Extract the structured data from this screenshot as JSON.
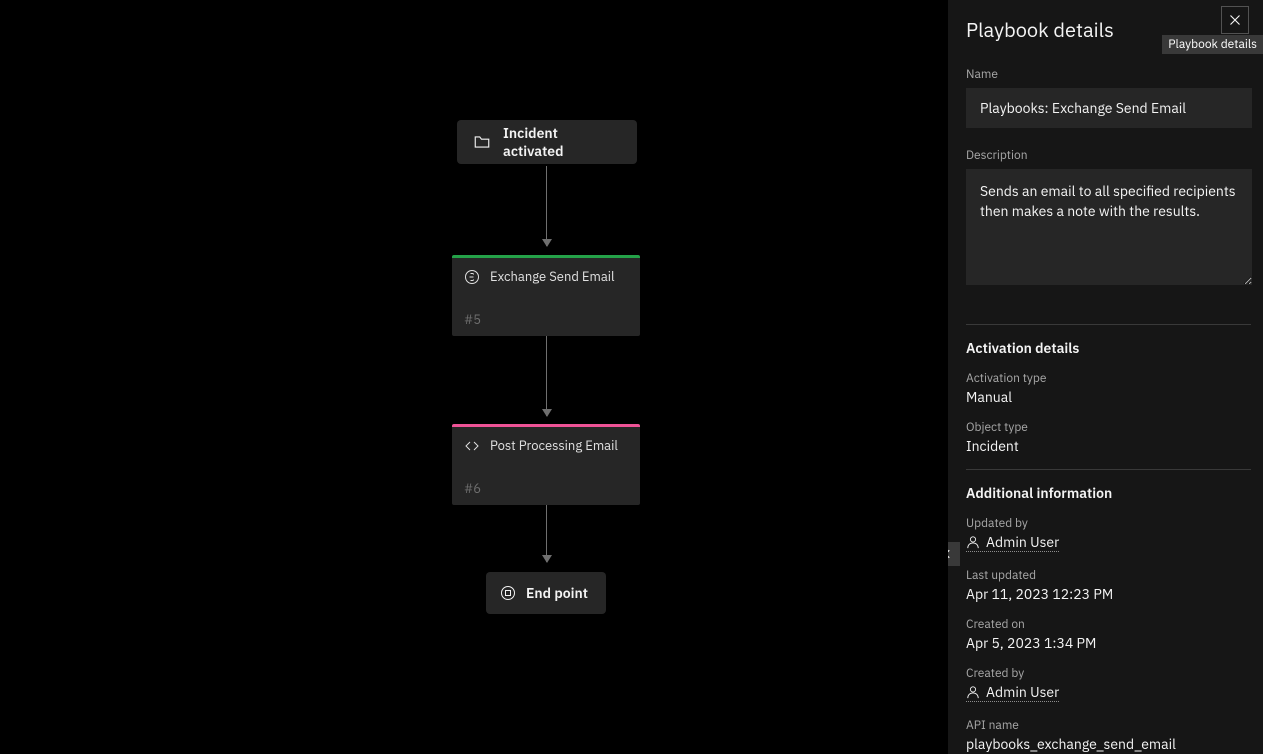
{
  "canvas": {
    "start_label": "Incident activated",
    "node_exchange": {
      "title": "Exchange Send Email",
      "sub": "#5"
    },
    "node_post": {
      "title": "Post Processing Email",
      "sub": "#6"
    },
    "end_label": "End point"
  },
  "panel": {
    "title": "Playbook details",
    "tooltip": "Playbook details",
    "name_label": "Name",
    "name_value": "Playbooks: Exchange Send Email",
    "desc_label": "Description",
    "desc_value": "Sends an email to all specified recipients then makes a note with the results.",
    "activation_head": "Activation details",
    "activation_type_label": "Activation type",
    "activation_type_value": "Manual",
    "object_type_label": "Object type",
    "object_type_value": "Incident",
    "additional_head": "Additional information",
    "updated_by_label": "Updated by",
    "updated_by_value": "Admin User",
    "last_updated_label": "Last updated",
    "last_updated_value": "Apr 11, 2023 12:23 PM",
    "created_on_label": "Created on",
    "created_on_value": "Apr 5, 2023 1:34 PM",
    "created_by_label": "Created by",
    "created_by_value": "Admin User",
    "api_name_label": "API name",
    "api_name_value": "playbooks_exchange_send_email"
  }
}
